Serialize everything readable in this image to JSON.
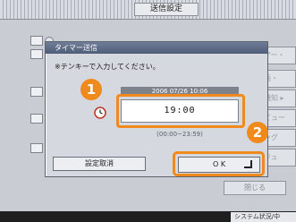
{
  "window": {
    "title": "送信設定"
  },
  "background": {
    "buttons": [
      "アー・",
      "画・",
      "通知 ▸",
      "ビュー",
      "ング",
      "ジュ"
    ],
    "close_label": "閉じる"
  },
  "dialog": {
    "title": "タイマー送信",
    "note": "※テンキーで入力してください。",
    "current_datetime": "2006 07/26 10:06",
    "time_value": "19:00",
    "time_range": "(00:00~23:59)",
    "cancel_label": "設定取消",
    "ok_label": "O K"
  },
  "callouts": {
    "step1": "1",
    "step2": "2"
  },
  "status": {
    "label": "システム状況/中"
  },
  "colors": {
    "highlight": "#f08a1c",
    "dialog_title": "#5b6985"
  }
}
